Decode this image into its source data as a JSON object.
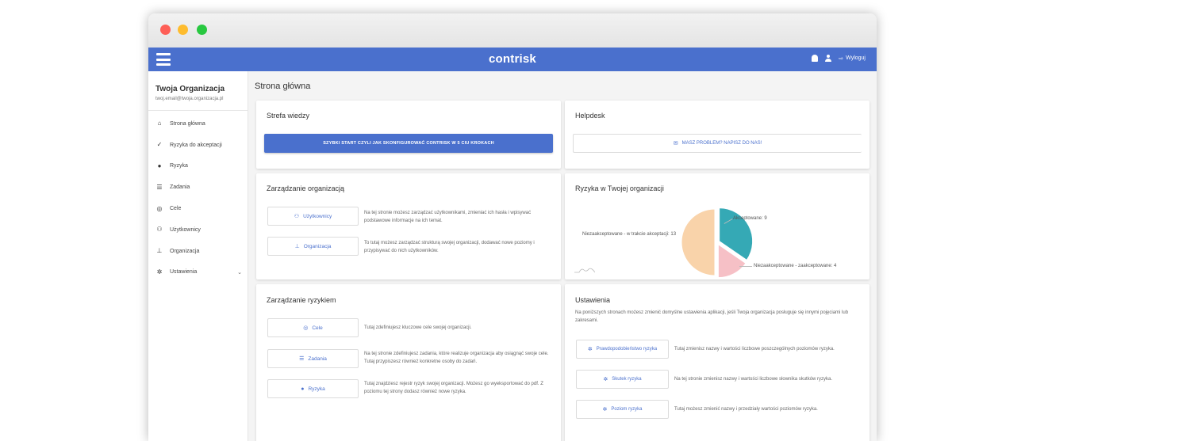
{
  "app": {
    "logo": "contrisk",
    "logout_label": "Wyloguj",
    "accent_color": "#4a70cd"
  },
  "sidebar": {
    "org_name": "Twoja Organizacja",
    "org_email": "twoj.email@twoja.organizacja.pl",
    "items": [
      {
        "label": "Strona główna",
        "icon": "home-icon"
      },
      {
        "label": "Ryzyka do akceptacji",
        "icon": "check-icon"
      },
      {
        "label": "Ryzyka",
        "icon": "circle-icon"
      },
      {
        "label": "Zadania",
        "icon": "list-icon"
      },
      {
        "label": "Cele",
        "icon": "target-icon"
      },
      {
        "label": "Użytkownicy",
        "icon": "users-icon"
      },
      {
        "label": "Organizacja",
        "icon": "sitemap-icon"
      },
      {
        "label": "Ustawienia",
        "icon": "gear-icon"
      }
    ]
  },
  "main": {
    "page_title": "Strona główna",
    "knowledge": {
      "title": "Strefa wiedzy",
      "button": "SZYBKI START CZYLI JAK SKONFIGUROWAĆ CONTRISK W 5 CIU KROKACH"
    },
    "helpdesk": {
      "title": "Helpdesk",
      "button": "MASZ PROBLEM? NAPISZ DO NAS!"
    },
    "org_management": {
      "title": "Zarządzanie organizacją",
      "rows": [
        {
          "button": "Użytkownicy",
          "icon": "users-icon",
          "text": "Na tej stronie możesz zarządzać użytkownikami, zmieniać ich hasła i wpisywać podstawowe informacje na ich temat."
        },
        {
          "button": "Organizacja",
          "icon": "sitemap-icon",
          "text": "To tutaj możesz zarządzać strukturą swojej organizacji, dodawać nowe poziomy i przypisywać do nich użytkowników."
        }
      ]
    },
    "org_risks": {
      "title": "Ryzyka w Twojej organizacji",
      "labels": {
        "accepted": "Akceptowane: 9",
        "pending": "Niezaakceptowane - w trakcie akceptacji: 13",
        "rejected": "Niezaakceptowane - zaakceptowane: 4"
      },
      "colors": {
        "accepted": "#35a9b5",
        "pending": "#f9d3aa",
        "rejected": "#f6c0c6"
      }
    },
    "risk_management": {
      "title": "Zarządzanie ryzykiem",
      "rows": [
        {
          "button": "Cele",
          "icon": "target-icon",
          "text": "Tutaj zdefiniujesz kluczowe cele swojej organizacji."
        },
        {
          "button": "Zadania",
          "icon": "list-icon",
          "text": "Na tej stronie zdefiniujesz zadania, które realizuje organizacja aby osiągnąć swoje cele. Tutaj przypiszesz również konkretne osoby do zadań."
        },
        {
          "button": "Ryzyka",
          "icon": "circle-icon",
          "text": "Tutaj znajdziesz rejestr ryzyk swojej organizacji. Możesz go wyeksportować do pdf. Z poziomu tej strony dodasz również nowe ryzyka."
        }
      ]
    },
    "settings": {
      "title": "Ustawienia",
      "intro": "Na poniższych stronach możesz zmienić domyślne ustawienia aplikacji, jeśli Twoja organizacja posługuje się innymi pojęciami lub zakresami.",
      "rows": [
        {
          "button": "Prawdopodobieństwo ryzyka",
          "icon": "gear-icon",
          "text": "Tutaj zmienisz nazwy i wartości liczbowe poszczególnych poziomów ryzyka."
        },
        {
          "button": "Skutek ryzyka",
          "icon": "gear-icon",
          "text": "Na tej stronie zmienisz nazwy i wartości liczbowe słownika skutków ryzyka."
        },
        {
          "button": "Poziom ryzyka",
          "icon": "gear-icon",
          "text": "Tutaj możesz zmienić nazwy i przedziały wartości poziomów ryzyka."
        }
      ]
    }
  },
  "chart_data": {
    "type": "pie",
    "title": "Ryzyka w Twojej organizacji",
    "categories": [
      "Akceptowane",
      "Niezaakceptowane - w trakcie akceptacji",
      "Niezaakceptowane - zaakceptowane"
    ],
    "values": [
      9,
      13,
      4
    ],
    "colors": [
      "#35a9b5",
      "#f9d3aa",
      "#f6c0c6"
    ]
  }
}
